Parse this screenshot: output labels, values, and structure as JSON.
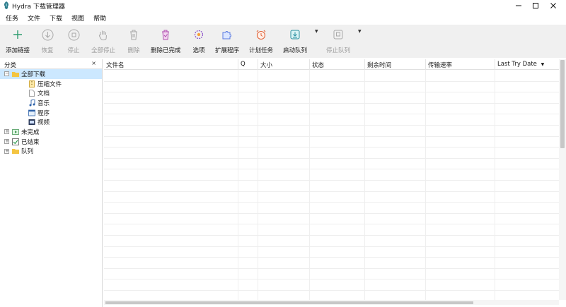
{
  "window": {
    "title": "Hydra 下载管理器",
    "controls": [
      "minimize-icon",
      "maximize-icon",
      "close-icon"
    ]
  },
  "menu": [
    "任务",
    "文件",
    "下载",
    "视图",
    "帮助"
  ],
  "toolbar": {
    "add": "添加链接",
    "resume": "恢复",
    "stop": "停止",
    "stop_all": "全部停止",
    "delete": "删除",
    "delete_completed": "删除已完成",
    "options": "选项",
    "extensions": "扩展程序",
    "scheduler": "计划任务",
    "start_queue": "启动队列",
    "stop_queue": "停止队列"
  },
  "sidebar": {
    "header": "分类",
    "close": "×",
    "tree": {
      "all": "全部下载",
      "compressed": "压缩文件",
      "documents": "文档",
      "music": "音乐",
      "programs": "程序",
      "video": "视频",
      "unfinished": "未完成",
      "finished": "已结束",
      "queues": "队列"
    }
  },
  "table": {
    "columns": [
      "文件名",
      "Q",
      "大小",
      "状态",
      "剩余时间",
      "传输速率",
      "Last Try Date"
    ],
    "sort_indicator": "▼",
    "rows": []
  },
  "colors": {
    "accent": "#2e9c6f",
    "selection": "#cce8ff",
    "toolbar_bg": "#f0f0f0",
    "folder": "#f4c542",
    "disabled": "#9a9a9a"
  }
}
